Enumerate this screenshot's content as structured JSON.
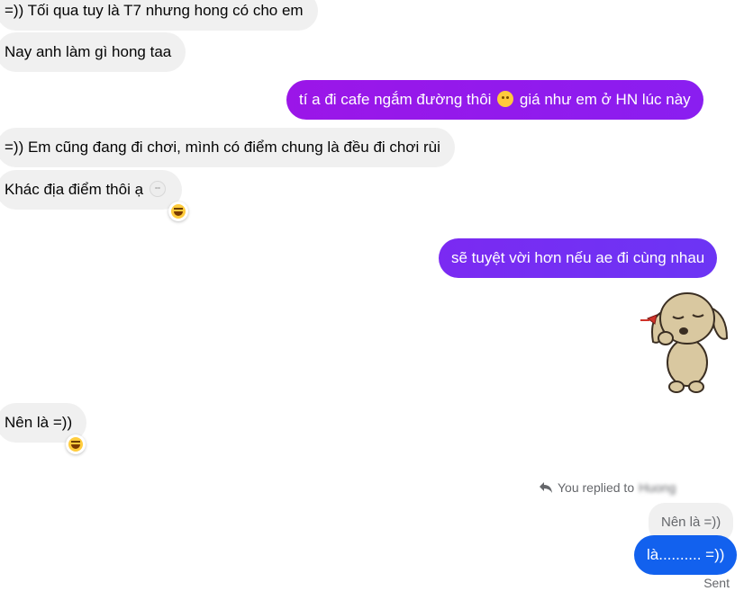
{
  "messages": {
    "m1": "=)) Tối qua tuy là T7 nhưng hong có cho em",
    "m2": "Nay anh làm gì hong taa",
    "m3_before": "tí a đi cafe ngắm đường thôi",
    "m3_after": "giá như em ở HN lúc này",
    "m4": "=)) Em cũng đang đi chơi, mình có điểm chung là đều đi chơi rùi",
    "m5": "Khác địa điểm thôi ạ",
    "m6": "sẽ tuyệt vời hơn nếu ae đi cùng nhau",
    "m7": "Nên là =))",
    "m8": "là.......... =))"
  },
  "reply": {
    "label": "You replied to",
    "name": "Huong",
    "quoted_text": "Nên là =))"
  },
  "status": "Sent",
  "colors": {
    "incoming_bg": "#f0f0f0",
    "outgoing_purple": "#9b16e8",
    "outgoing_violet": "#7b2af2",
    "outgoing_blue": "#1261ee"
  },
  "icons": {
    "reaction": "laughing-emoji",
    "sad": "sad-emoji",
    "grin": "grin-emoji",
    "reply": "reply-arrow-icon",
    "sticker": "dog-sticker"
  }
}
